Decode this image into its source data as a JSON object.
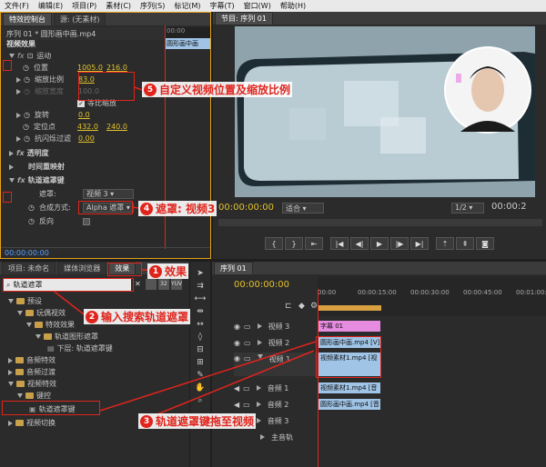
{
  "menu": [
    "文件(F)",
    "编辑(E)",
    "项目(P)",
    "素材(C)",
    "序列(S)",
    "标记(M)",
    "字幕(T)",
    "窗口(W)",
    "帮助(H)"
  ],
  "effect_controls": {
    "tab_main": "特效控制台",
    "tab_source": "源: (无素材)",
    "sequence_label": "序列 01 * 圆形画中画.mp4",
    "time_start": "00:00",
    "clip_bar_label": "圆形画中画",
    "section_title": "视频效果",
    "motion": "运动",
    "position_label": "位置",
    "position_x": "1005.0",
    "position_y": "216.0",
    "scale_label": "缩放比例",
    "scale_value": "83.0",
    "scale_width_label": "缩放宽度",
    "scale_width_value": "100.0",
    "uniform_scale": "等比缩放",
    "rotation_label": "旋转",
    "rotation_value": "0.0",
    "anchor_label": "定位点",
    "anchor_x": "432.0",
    "anchor_y": "240.0",
    "antiflicker_label": "抗闪烁过滤",
    "antiflicker_value": "0.00",
    "opacity": "透明度",
    "time_remap": "时间重映射",
    "track_matte": "轨道遮罩键",
    "matte_label": "遮罩:",
    "matte_value": "视频 3",
    "composite_label": "合成方式:",
    "composite_value": "Alpha 遮罩",
    "reverse_label": "反向",
    "timecode": "00:00:00:00"
  },
  "program": {
    "tab": "节目: 序列 01",
    "timecode": "00:00:00:00",
    "fit": "适合",
    "ratio": "1/2",
    "timecode_right": "00:00:2"
  },
  "project": {
    "tabs": [
      "项目: 未命名",
      "媒体浏览器",
      "效果"
    ],
    "search_value": "轨道遮罩",
    "tree": [
      {
        "label": "预设",
        "level": 0
      },
      {
        "label": "玩偶视效",
        "level": 1
      },
      {
        "label": "特效效果",
        "level": 2
      },
      {
        "label": "轨道图形遮罩",
        "level": 3
      },
      {
        "label": "下层: 轨道遮罩键",
        "level": 4
      },
      {
        "label": "音频特效",
        "level": 0
      },
      {
        "label": "音频过渡",
        "level": 0
      },
      {
        "label": "视频特效",
        "level": 0
      },
      {
        "label": "键控",
        "level": 1
      },
      {
        "label": "轨道遮罩键",
        "level": 2
      },
      {
        "label": "视频切换",
        "level": 0
      }
    ]
  },
  "timeline": {
    "tab": "序列 01",
    "timecode": "00:00:00:00",
    "ruler": [
      "00:00",
      "00:00:15:00",
      "00:00:30:00",
      "00:00:45:00",
      "00:01:00:00"
    ],
    "tracks": [
      {
        "name": "视频 3",
        "clip": "字幕 01"
      },
      {
        "name": "视频 2",
        "clip": "圆形画中画.mp4 [V]"
      },
      {
        "name": "视频 1",
        "clip": "视频素材1.mp4 [视"
      },
      {
        "name": "音频 1",
        "clip": "视频素材1.mp4 [音"
      },
      {
        "name": "音频 2",
        "clip": "圆形画中画.mp4 [音"
      },
      {
        "name": "音频 3",
        "clip": ""
      },
      {
        "name": "主音轨",
        "clip": ""
      }
    ]
  },
  "annotations": [
    {
      "num": "1",
      "text": "效果"
    },
    {
      "num": "2",
      "text": "输入搜索轨道遮罩"
    },
    {
      "num": "3",
      "text": "轨道遮罩键拖至视频"
    },
    {
      "num": "4",
      "text": "遮罩: 视频3"
    },
    {
      "num": "5",
      "text": "自定义视频位置及缩放比例"
    }
  ],
  "colors": {
    "annot_red": "#e0241c",
    "value_blue": "#5aa0ff",
    "value_yellow": "#e3c22b",
    "title_clip": "#e58ce0",
    "video_clip": "#9fc4e6"
  }
}
